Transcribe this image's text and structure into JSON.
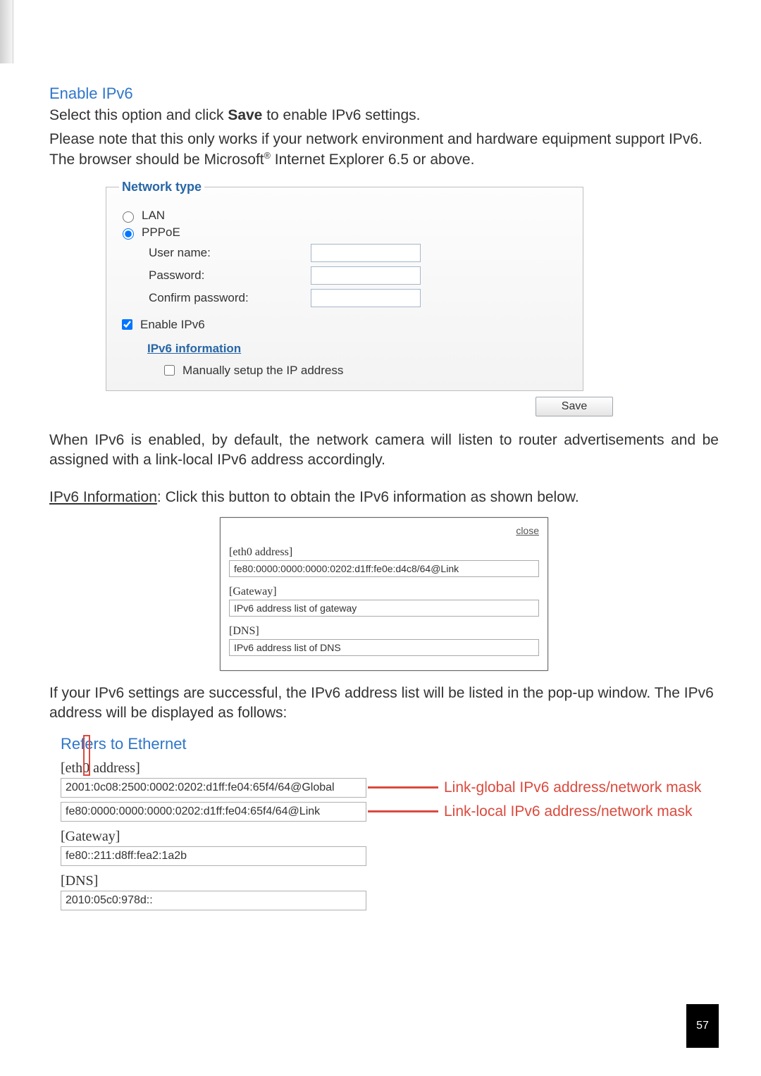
{
  "section": {
    "title": "Enable IPv6",
    "intro1_a": "Select this option and click ",
    "intro1_b": "Save",
    "intro1_c": " to enable IPv6 settings.",
    "intro2_a": "Please note that this only works if your network environment and hardware equipment support IPv6. The browser should be Microsoft",
    "intro2_b": " Internet Explorer 6.5 or above."
  },
  "panel": {
    "legend": "Network type",
    "lan": "LAN",
    "pppoe": "PPPoE",
    "username_label": "User name:",
    "password_label": "Password:",
    "confirm_label": "Confirm password:",
    "enable_ipv6": "Enable IPv6",
    "ipv6_info_link": "IPv6 information",
    "manual_ip": "Manually setup the IP address",
    "save": "Save"
  },
  "afterpanel": {
    "p1": "When IPv6 is enabled, by default, the network camera will listen to router advertisements and be assigned with a link-local IPv6 address accordingly.",
    "p2_a": "IPv6 Information",
    "p2_b": ": Click this button to obtain the IPv6 information as shown below."
  },
  "popup": {
    "close": "close",
    "eth0_h": "[eth0 address]",
    "eth0_v": "fe80:0000:0000:0000:0202:d1ff:fe0e:d4c8/64@Link",
    "gw_h": "[Gateway]",
    "gw_v": "IPv6 address list of gateway",
    "dns_h": "[DNS]",
    "dns_v": "IPv6 address list of DNS"
  },
  "afterpopup": {
    "p1": "If your IPv6 settings are successful, the IPv6 address list will be listed in the pop-up window. The IPv6 address will be displayed as follows:"
  },
  "ethernet": {
    "title": "Refers to Ethernet",
    "eth0_h": "[eth0 address]",
    "global_addr": "2001:0c08:2500:0002:0202:d1ff:fe04:65f4/64@Global",
    "link_addr": "fe80:0000:0000:0000:0202:d1ff:fe04:65f4/64@Link",
    "gw_h": "[Gateway]",
    "gw_v": "fe80::211:d8ff:fea2:1a2b",
    "dns_h": "[DNS]",
    "dns_v": "2010:05c0:978d::",
    "callout_global": "Link-global IPv6 address/network mask",
    "callout_link": "Link-local IPv6 address/network mask"
  },
  "page_number": "57"
}
